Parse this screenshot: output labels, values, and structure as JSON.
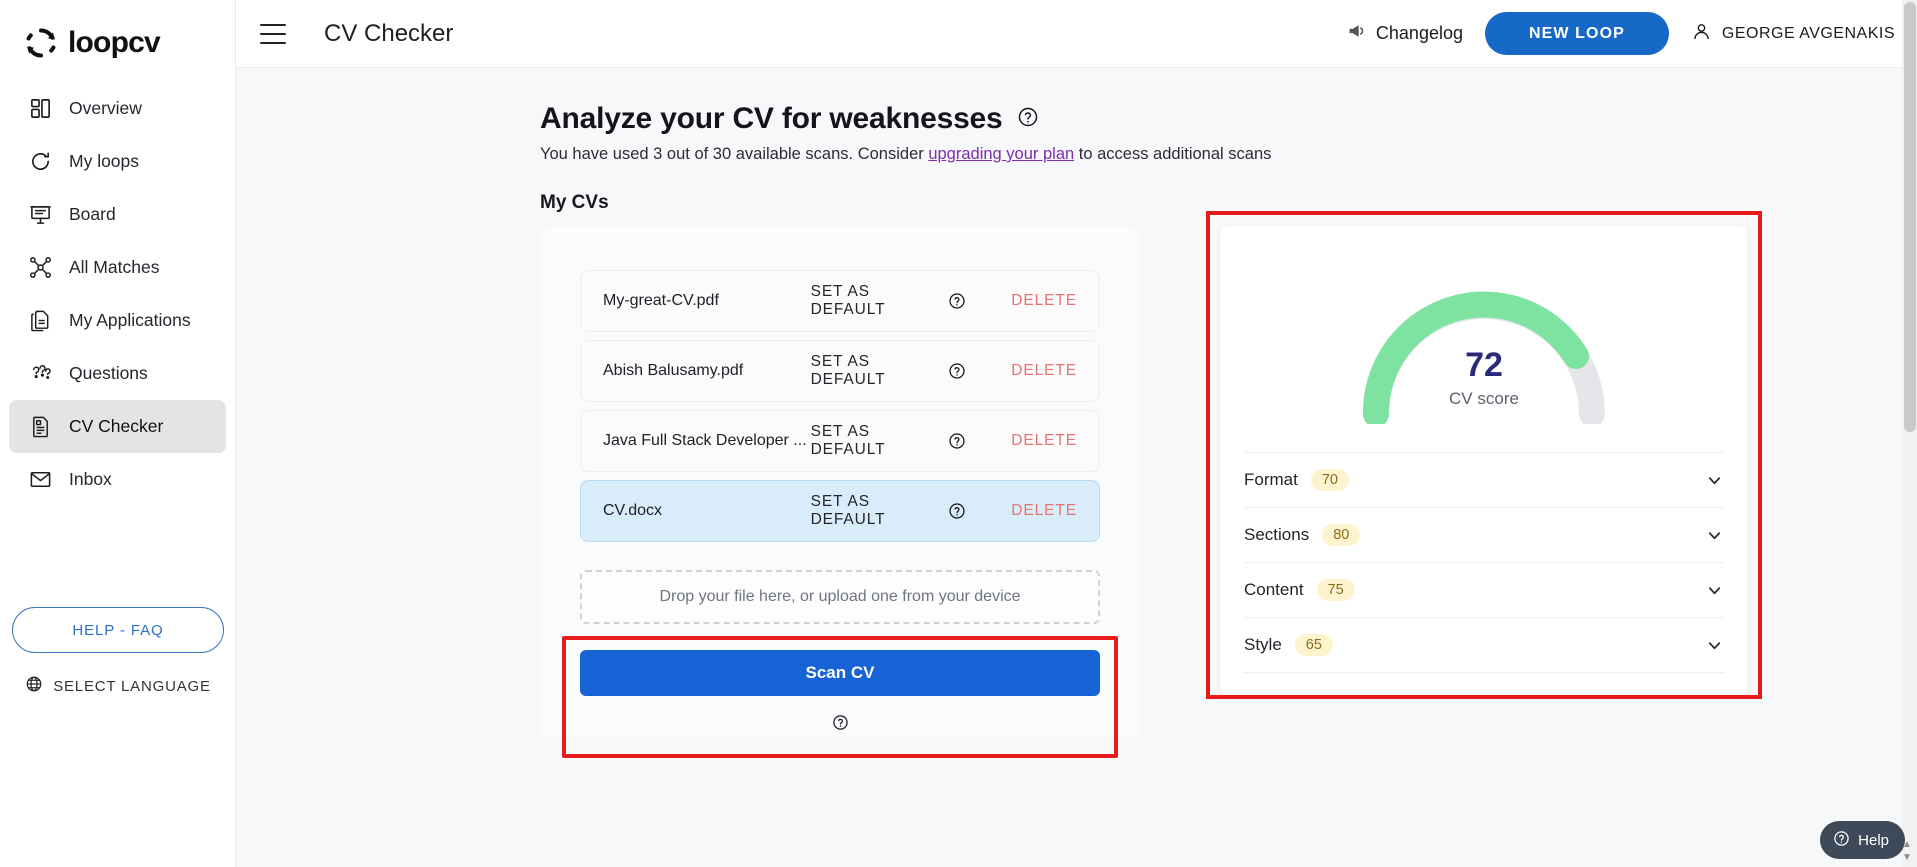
{
  "brand": {
    "name": "loopcv",
    "logo_icon": "loop-refresh-icon"
  },
  "sidebar": {
    "items": [
      {
        "label": "Overview",
        "icon": "dashboard-grid-icon",
        "active": false
      },
      {
        "label": "My loops",
        "icon": "refresh-loop-icon",
        "active": false
      },
      {
        "label": "Board",
        "icon": "presentation-board-icon",
        "active": false
      },
      {
        "label": "All Matches",
        "icon": "network-nodes-icon",
        "active": false
      },
      {
        "label": "My Applications",
        "icon": "documents-stack-icon",
        "active": false
      },
      {
        "label": "Questions",
        "icon": "question-marks-icon",
        "active": false
      },
      {
        "label": "CV Checker",
        "icon": "cv-document-icon",
        "active": true
      },
      {
        "label": "Inbox",
        "icon": "envelope-icon",
        "active": false
      }
    ],
    "help_faq_label": "HELP - FAQ",
    "select_language_label": "SELECT LANGUAGE",
    "globe_icon": "globe-icon"
  },
  "topbar": {
    "menu_icon": "hamburger-menu-icon",
    "page_title": "CV Checker",
    "changelog_label": "Changelog",
    "changelog_icon": "megaphone-icon",
    "new_loop_label": "NEW LOOP",
    "account_name": "GEORGE AVGENAKIS",
    "account_icon": "user-avatar-icon"
  },
  "main": {
    "heading": "Analyze your CV for weaknesses",
    "heading_help_icon": "question-circle-icon",
    "subtitle_prefix": "You have used 3 out of 30 available scans. Consider ",
    "subtitle_link": "upgrading your plan",
    "subtitle_suffix": " to access additional scans",
    "section_title": "My CVs",
    "scans_used": 3,
    "scans_total": 30
  },
  "cv_list": {
    "set_default_label": "SET AS DEFAULT",
    "delete_label": "DELETE",
    "help_icon": "question-circle-icon",
    "items": [
      {
        "name": "My-great-CV.pdf",
        "selected": false
      },
      {
        "name": "Abish Balusamy.pdf",
        "selected": false
      },
      {
        "name": "Java Full Stack Developer ...",
        "selected": false
      },
      {
        "name": "CV.docx",
        "selected": true
      }
    ]
  },
  "upload": {
    "dropzone_text": "Drop your file here, or upload one from your device",
    "scan_button_label": "Scan CV"
  },
  "score_panel": {
    "score": "72",
    "score_label": "CV score",
    "gauge_fill_color": "#7ee2a0",
    "gauge_track_color": "#e4e6e9",
    "score_text_color": "#2a2a78",
    "chevron_icon": "chevron-down-icon",
    "categories": [
      {
        "label": "Format",
        "value": "70"
      },
      {
        "label": "Sections",
        "value": "80"
      },
      {
        "label": "Content",
        "value": "75"
      },
      {
        "label": "Style",
        "value": "65"
      }
    ]
  },
  "widgets": {
    "help_bubble_label": "Help",
    "help_bubble_icon": "question-circle-icon"
  },
  "annotations": {
    "highlight_color": "#e81b1b"
  }
}
